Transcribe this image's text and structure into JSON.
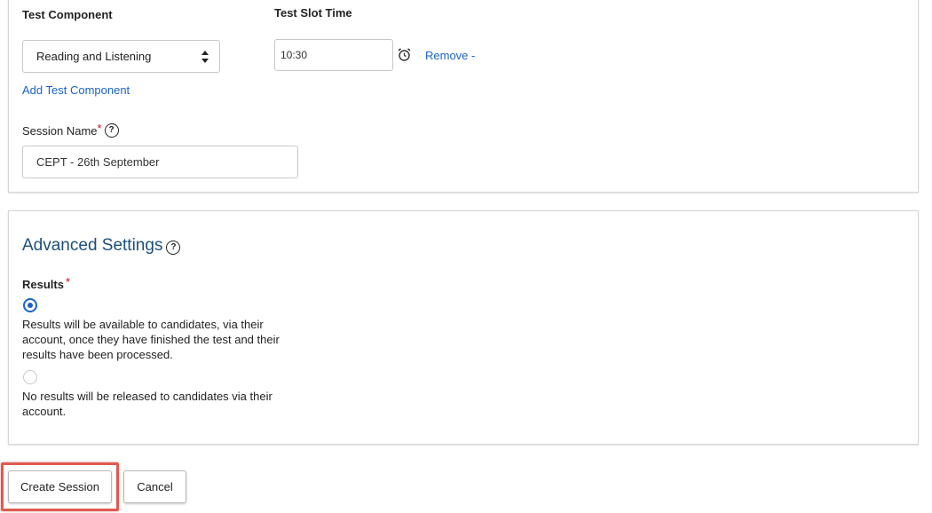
{
  "test_component": {
    "label": "Test Component",
    "selected": "Reading and Listening",
    "add_link": "Add Test Component"
  },
  "test_slot_time": {
    "label": "Test Slot Time",
    "value": "10:30",
    "remove_link": "Remove -"
  },
  "session_name": {
    "label": "Session Name",
    "required_mark": "*",
    "help_glyph": "?",
    "value": "CEPT - 26th September"
  },
  "advanced_settings": {
    "title": "Advanced Settings",
    "help_glyph": "?",
    "results": {
      "label": "Results",
      "required_mark": "*",
      "options": [
        {
          "text": "Results will be available to candidates, via their account, once they have finished the test and their results have been processed.",
          "selected": true
        },
        {
          "text": "No results will be released to candidates via their account.",
          "selected": false
        }
      ]
    }
  },
  "actions": {
    "create_label": "Create Session",
    "cancel_label": "Cancel"
  },
  "colors": {
    "link": "#1a63c7",
    "heading": "#1c4f7d",
    "required": "#d0021b",
    "highlight": "#e05a4f"
  },
  "icons": {
    "select_arrows": "updown-arrows-icon",
    "clock": "alarm-clock-icon",
    "help": "help-icon"
  }
}
